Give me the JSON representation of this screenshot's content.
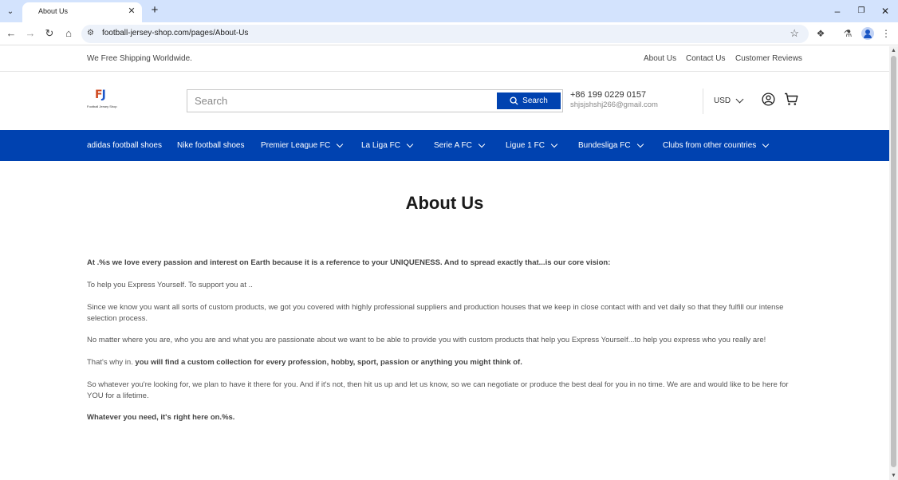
{
  "browser": {
    "tab_title": "About Us",
    "url": "football-jersey-shop.com/pages/About-Us"
  },
  "announcement": {
    "text": "We Free Shipping Worldwide.",
    "links": [
      "About Us",
      "Contact Us",
      "Customer Reviews"
    ]
  },
  "header": {
    "logo_mark": "FJ",
    "logo_text": "Football Jersey Shop",
    "search_placeholder": "Search",
    "search_button": "Search",
    "phone": "+86 199 0229 0157",
    "email": "shjsjshshj266@gmail.com",
    "currency": "USD"
  },
  "nav": {
    "items": [
      {
        "label": "adidas football shoes",
        "has_dropdown": false
      },
      {
        "label": "Nike football shoes",
        "has_dropdown": false
      },
      {
        "label": "Premier League FC",
        "has_dropdown": true
      },
      {
        "label": "La Liga FC",
        "has_dropdown": true
      },
      {
        "label": "Serie A FC",
        "has_dropdown": true
      },
      {
        "label": "Ligue 1 FC",
        "has_dropdown": true
      },
      {
        "label": "Bundesliga FC",
        "has_dropdown": true
      },
      {
        "label": "Clubs from other countries",
        "has_dropdown": true
      }
    ]
  },
  "content": {
    "title": "About Us",
    "p1": "At .%s we love every passion and interest on Earth because it is a reference to your UNIQUENESS. And to spread exactly that...is our core vision:",
    "p2": "To help you Express Yourself. To support you at ..",
    "p3": "Since we know you want all sorts of custom products, we got you covered with highly professional suppliers and production houses that we keep in close contact with and vet daily so that they fulfill our intense selection process.",
    "p4": "No matter where you are, who you are and what you are passionate about we want to be able to provide you with custom products that help you Express Yourself...to help you express who you really are!",
    "p5_pre": "That's why in. ",
    "p5_bold": "you will find a custom collection for every profession, hobby, sport, passion or anything you might think of.",
    "p6": "So whatever you're looking for, we plan to have it there for you. And if it's not, then hit us up and let us know, so we can negotiate or produce the best deal for you in no time. We are and would like to be here for YOU for a lifetime.",
    "p7": "Whatever you need, it's right here on.%s."
  },
  "colors": {
    "brand_blue": "#0042b0",
    "chrome_tab_bar": "#d3e3fd"
  }
}
